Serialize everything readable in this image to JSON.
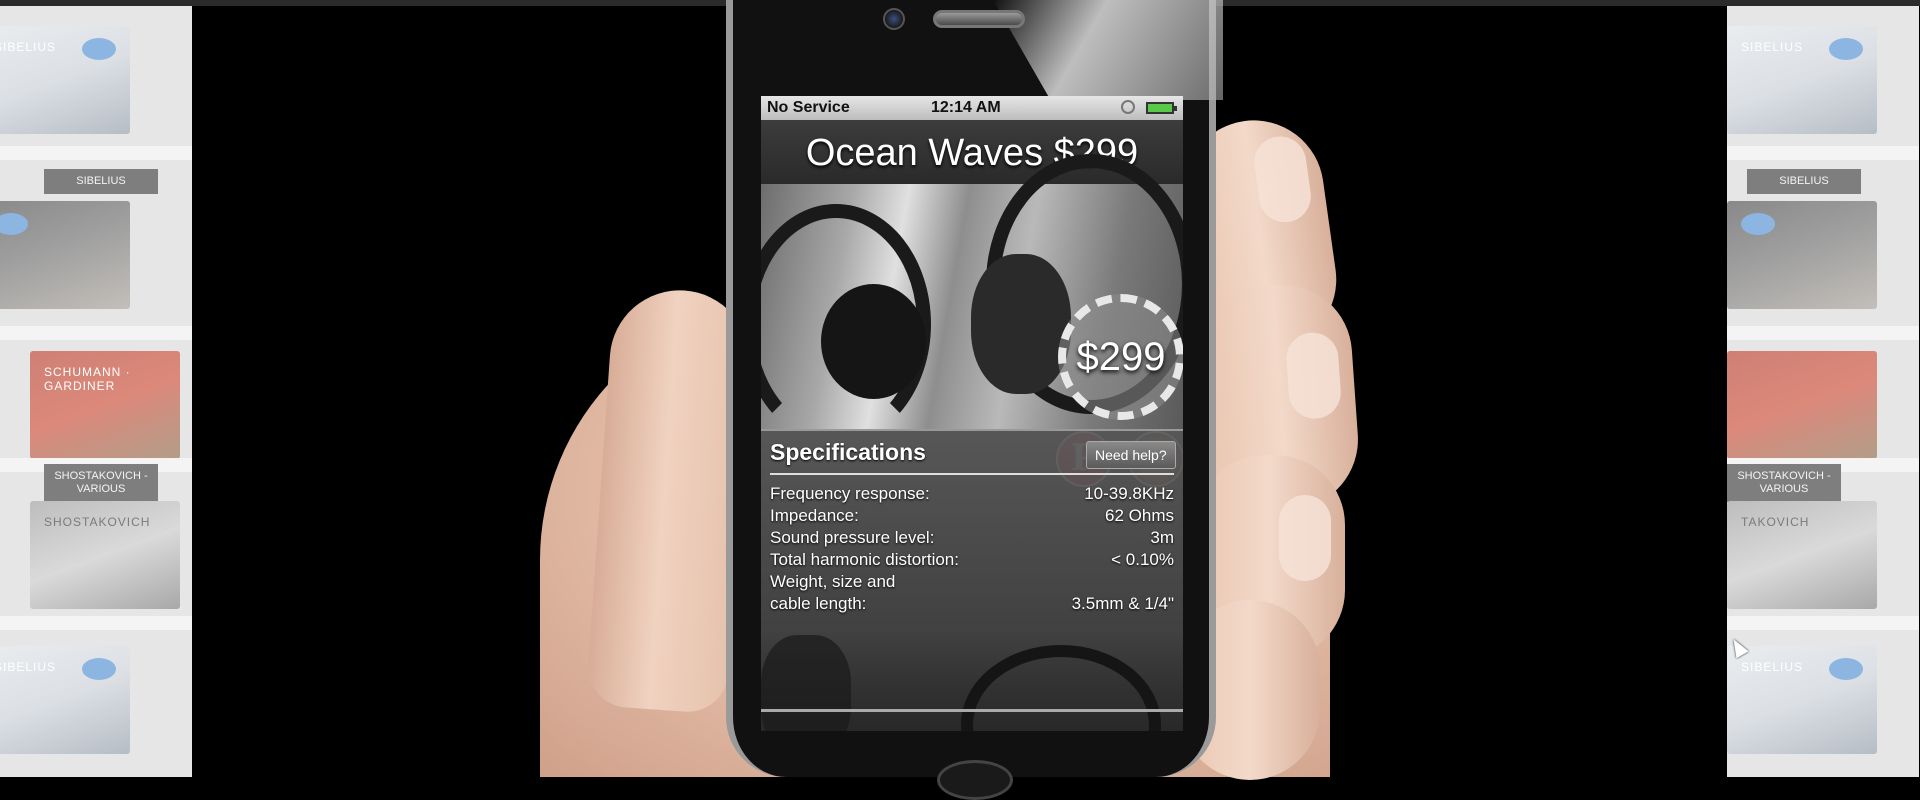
{
  "shelves": {
    "left": [
      {
        "text": "SIBELIUS",
        "style": "blue"
      },
      {
        "text": "SIBELIUS",
        "style": "dark",
        "caption": "SIBELIUS"
      },
      {
        "text": "SCHUMANN · GARDINER",
        "style": "red"
      },
      {
        "text": "SHOSTAKOVICH",
        "style": "gray",
        "caption": "SHOSTAKOVICH - VARIOUS"
      },
      {
        "text": "SIBELIUS",
        "style": "blue"
      }
    ],
    "right": [
      {
        "text": "SIBELIUS",
        "style": "blue"
      },
      {
        "text": "SIBELIUS",
        "style": "dark",
        "caption": "SIBELIUS"
      },
      {
        "text": "",
        "style": "red"
      },
      {
        "text": "TAKOVICH",
        "style": "gray",
        "caption": "SHOSTAKOVICH - VARIOUS"
      },
      {
        "text": "SIBELIUS",
        "style": "blue"
      }
    ]
  },
  "status_bar": {
    "carrier": "No Service",
    "time": "12:14 AM",
    "icons": [
      "orientation-lock-icon",
      "battery-icon"
    ]
  },
  "app": {
    "title": "Ocean Waves $299",
    "price_badge": "$299",
    "pinterest_glyph": "P",
    "specs_title": "Specifications",
    "need_help_label": "Need help?",
    "specs": [
      {
        "label": "Frequency response:",
        "value": "10-39.8KHz"
      },
      {
        "label": "Impedance:",
        "value": "62 Ohms"
      },
      {
        "label": "Sound pressure level:",
        "value": "3m"
      },
      {
        "label": "Total harmonic distortion:",
        "value": "< 0.10%"
      },
      {
        "label": "Weight, size and\ncable length:",
        "value": "3.5mm & 1/4\""
      }
    ]
  },
  "colors": {
    "pinterest": "#d0203a",
    "battery": "#59c94a",
    "background": "#000000"
  }
}
